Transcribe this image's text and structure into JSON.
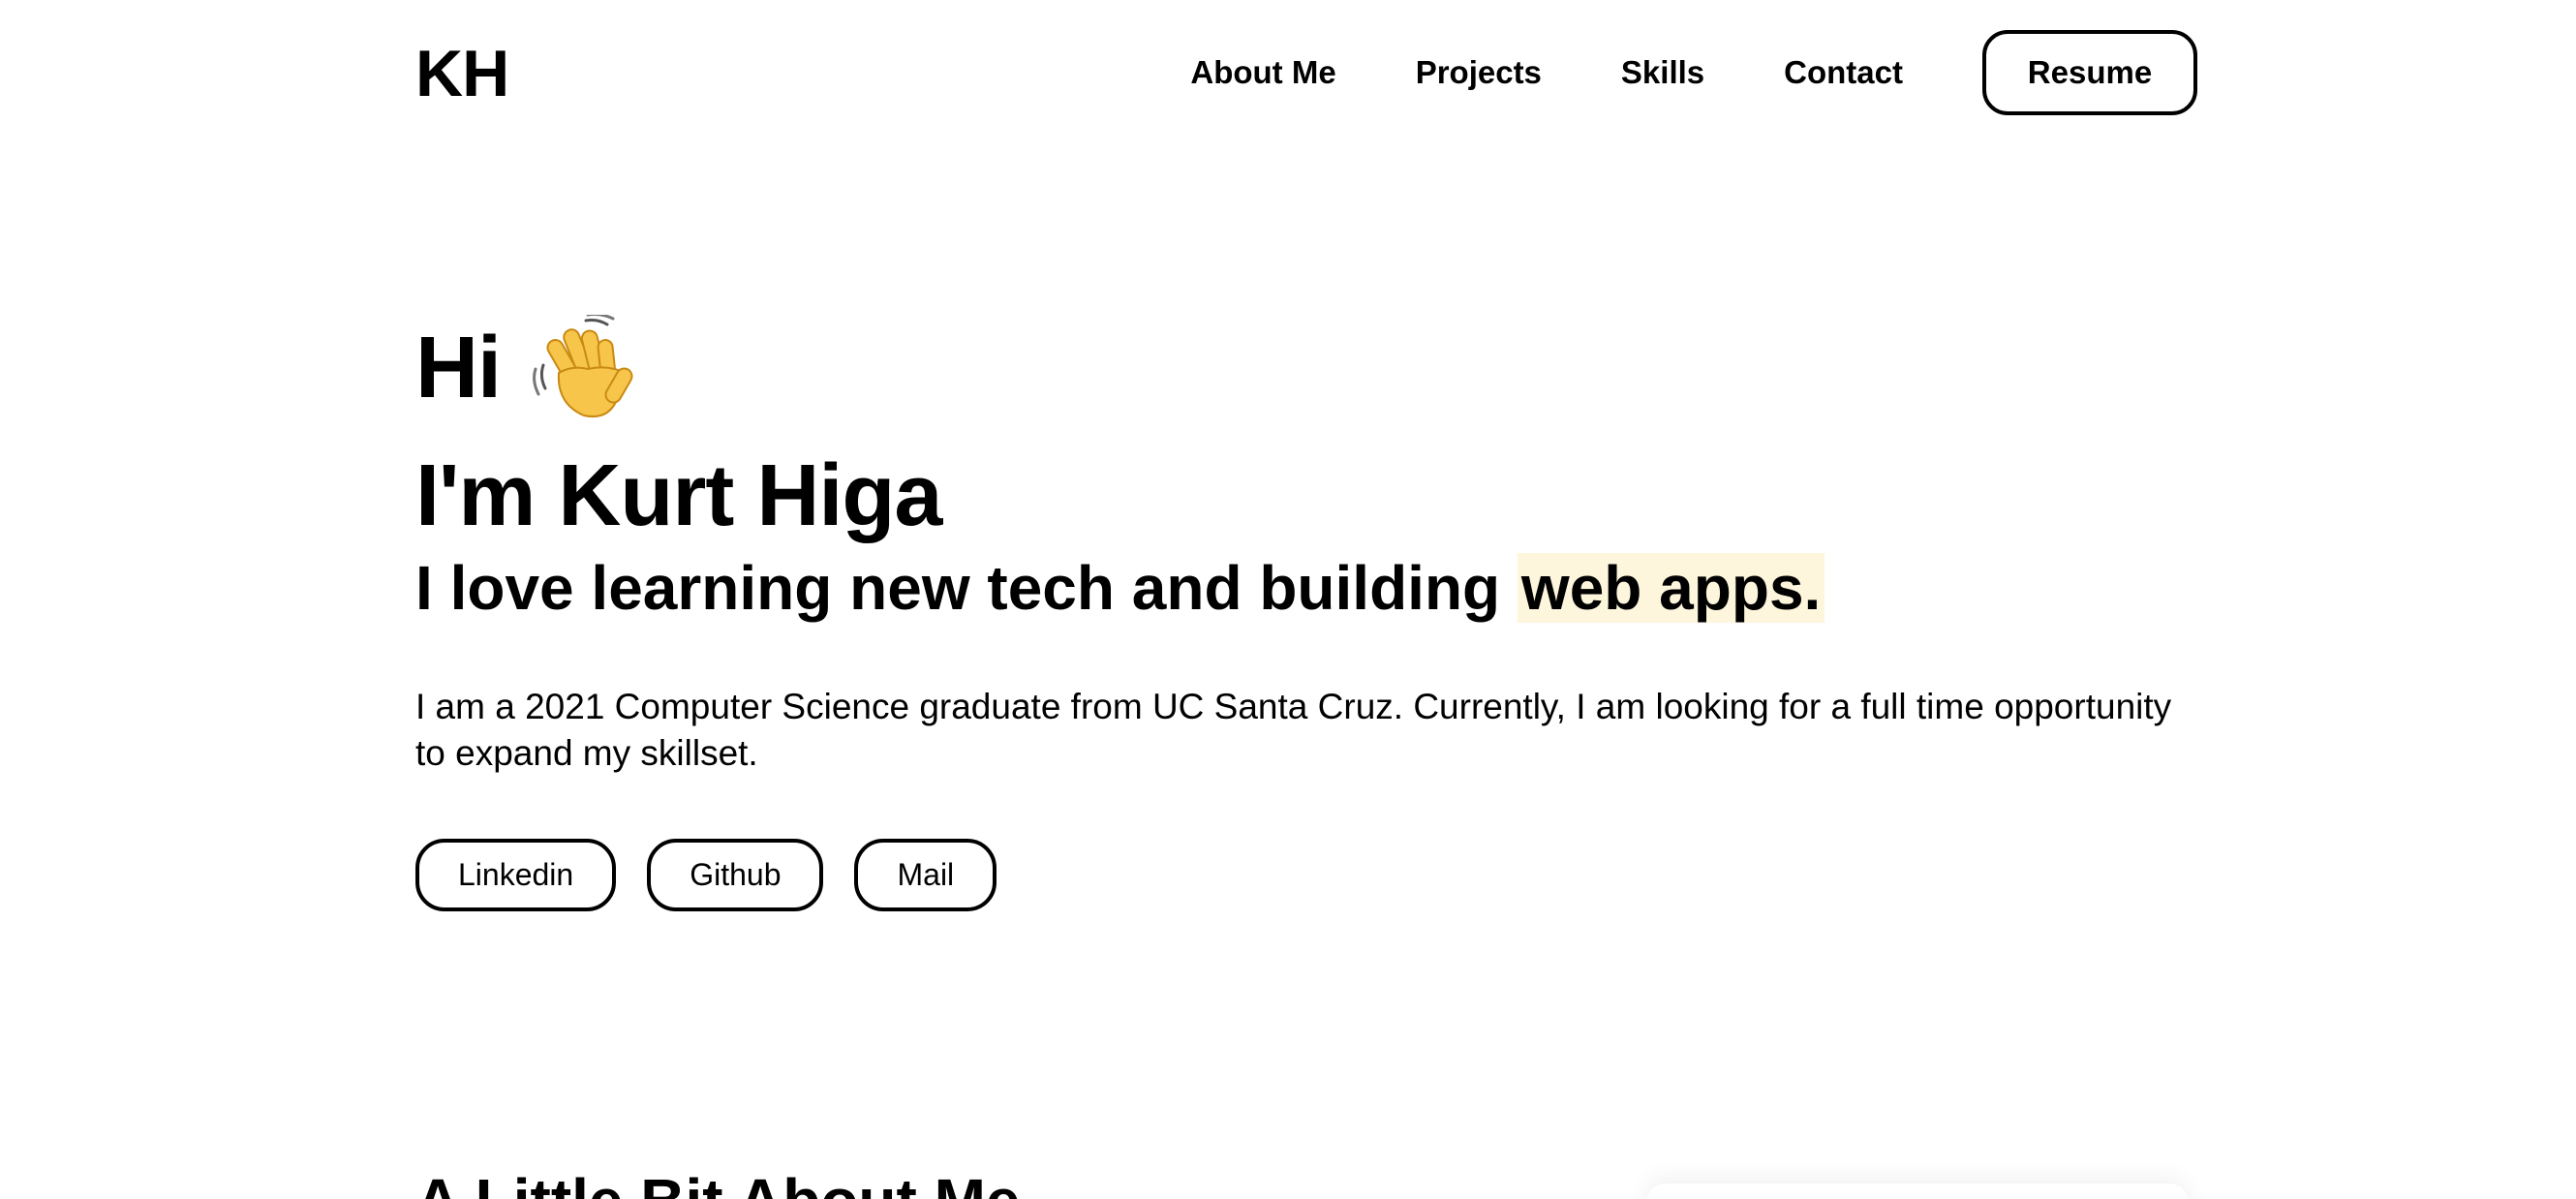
{
  "header": {
    "logo": "KH",
    "nav": [
      "About Me",
      "Projects",
      "Skills",
      "Contact"
    ],
    "resume_label": "Resume"
  },
  "hero": {
    "greeting": "Hi",
    "greeting_icon": "waving-hand-icon",
    "intro": "I'm Kurt Higa",
    "tagline_prefix": "I love learning new tech and building",
    "tagline_highlight": "web apps.",
    "highlight_color": "#fdf5dc",
    "bio": "I am a 2021 Computer Science graduate from UC Santa Cruz. Currently, I am looking for a full time opportunity to expand my skillset.",
    "social_links": [
      "Linkedin",
      "Github",
      "Mail"
    ]
  },
  "about": {
    "heading": "A Little Bit About Me"
  }
}
